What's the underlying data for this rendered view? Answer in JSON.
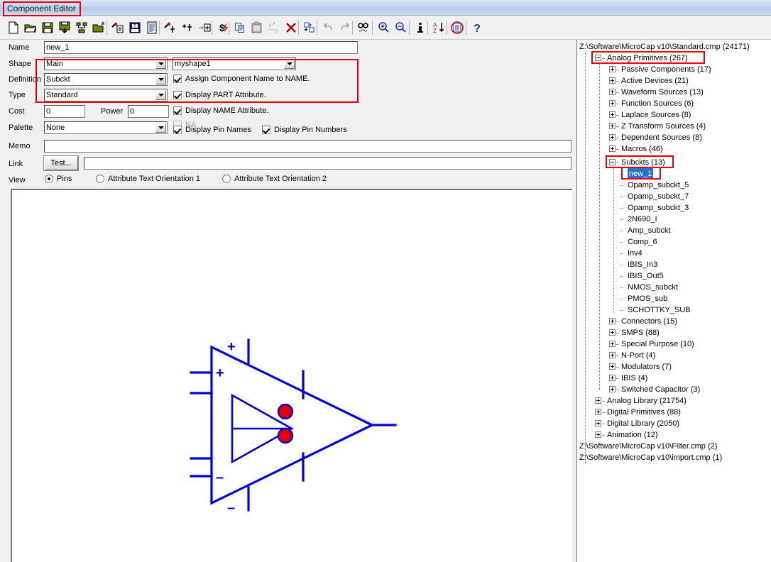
{
  "window": {
    "title": "Component Editor"
  },
  "toolbar": {
    "items": [
      {
        "name": "new-file-icon",
        "label": "New"
      },
      {
        "name": "open-folder-icon",
        "label": "Open"
      },
      {
        "name": "save-icon",
        "label": "Save"
      },
      {
        "name": "save-as-icon",
        "label": "Save As"
      },
      {
        "name": "merge-icon",
        "label": "Merge"
      },
      {
        "name": "add-folder-icon",
        "label": "Add Folder"
      },
      {
        "name": "add-part-wizard-icon",
        "label": "Add Part Wizard"
      },
      {
        "name": "add-part-icon",
        "label": "Add Part"
      },
      {
        "name": "add-group-icon",
        "label": "Add Group"
      },
      {
        "name": "subckt-wizard-icon",
        "label": "Subckt Wizard"
      },
      {
        "name": "add-pin-icon",
        "label": "Add Pin"
      },
      {
        "name": "move-into-icon",
        "label": "Move Into"
      },
      {
        "name": "cost-power-icon",
        "label": "Cost and Power"
      },
      {
        "name": "copy-icon",
        "label": "Copy"
      },
      {
        "name": "paste-icon",
        "label": "Paste"
      },
      {
        "name": "sort-ab-icon",
        "label": "Sort A to B"
      },
      {
        "name": "delete-icon",
        "label": "Delete"
      },
      {
        "name": "move-components-icon",
        "label": "Move Components"
      },
      {
        "name": "undo-icon",
        "label": "Undo"
      },
      {
        "name": "redo-icon",
        "label": "Redo"
      },
      {
        "name": "find-icon",
        "label": "Find"
      },
      {
        "name": "zoom-in-icon",
        "label": "Zoom In"
      },
      {
        "name": "zoom-out-icon",
        "label": "Zoom Out"
      },
      {
        "name": "info-icon",
        "label": "Info"
      },
      {
        "name": "sort-az-icon",
        "label": "Sort"
      },
      {
        "name": "filter-icon",
        "label": "Filter"
      },
      {
        "name": "help-icon",
        "label": "Help"
      }
    ]
  },
  "form": {
    "name": {
      "label": "Name",
      "value": "new_1"
    },
    "shape": {
      "label": "Shape",
      "value": "Main",
      "shape_name": "myshape1"
    },
    "definition": {
      "label": "Definition",
      "value": "Subckt"
    },
    "type": {
      "label": "Type",
      "value": "Standard"
    },
    "cost": {
      "label": "Cost",
      "value": "0"
    },
    "power": {
      "label": "Power",
      "value": "0"
    },
    "palette": {
      "label": "Palette",
      "value": "None"
    },
    "memo": {
      "label": "Memo",
      "value": ""
    },
    "link": {
      "label": "Link",
      "value": "",
      "test_button": "Test..."
    },
    "view": {
      "label": "View"
    },
    "checkboxes": [
      {
        "label": "Assign Component Name to NAME.",
        "checked": true,
        "disabled": false
      },
      {
        "label": "Display PART Attribute.",
        "checked": true,
        "disabled": false
      },
      {
        "label": "Display NAME Attribute.",
        "checked": true,
        "disabled": false
      },
      {
        "label": "NA",
        "checked": false,
        "disabled": true
      },
      {
        "label": "Display Pin Names",
        "checked": true,
        "disabled": false
      },
      {
        "label": "Display Pin Numbers",
        "checked": true,
        "disabled": false
      }
    ],
    "radios": [
      {
        "label": "Pins",
        "selected": true
      },
      {
        "label": "Attribute Text Orientation 1",
        "selected": false
      },
      {
        "label": "Attribute Text Orientation 2",
        "selected": false
      }
    ]
  },
  "symbol": {
    "plus_top": "+",
    "plus_in": "+",
    "minus_in": "–",
    "minus_bottom": "–",
    "line_color": "#0000d4",
    "pin_color": "#e00000"
  },
  "tree": {
    "files": [
      {
        "path": "Z:\\Software\\MicroCap v10\\Standard.cmp (24171)"
      },
      {
        "path": "Z:\\Software\\MicroCap v10\\Filter.cmp (2)"
      },
      {
        "path": "Z:\\Software\\MicroCap v10\\import.cmp (1)"
      }
    ],
    "groups": [
      {
        "label": "Analog Primitives (267)",
        "state": "expanded",
        "highlight": true
      },
      {
        "label": "Analog Library (21754)",
        "state": "collapsed",
        "highlight": false
      },
      {
        "label": "Digital Primitives (88)",
        "state": "collapsed",
        "highlight": false
      },
      {
        "label": "Digital Library (2050)",
        "state": "collapsed",
        "highlight": false
      },
      {
        "label": "Animation (12)",
        "state": "collapsed",
        "highlight": false
      }
    ],
    "analog_children": [
      {
        "label": "Passive Components (17)",
        "state": "collapsed"
      },
      {
        "label": "Active Devices (21)",
        "state": "collapsed"
      },
      {
        "label": "Waveform Sources (13)",
        "state": "collapsed"
      },
      {
        "label": "Function Sources (6)",
        "state": "collapsed"
      },
      {
        "label": "Laplace Sources (8)",
        "state": "collapsed"
      },
      {
        "label": "Z Transform Sources (4)",
        "state": "collapsed"
      },
      {
        "label": "Dependent Sources (8)",
        "state": "collapsed"
      },
      {
        "label": "Macros (46)",
        "state": "collapsed"
      },
      {
        "label": "Subckts (13)",
        "state": "expanded",
        "highlight": true
      },
      {
        "label": "Connectors (15)",
        "state": "collapsed"
      },
      {
        "label": "SMPS (88)",
        "state": "collapsed"
      },
      {
        "label": "Special Purpose (10)",
        "state": "collapsed"
      },
      {
        "label": "N-Port (4)",
        "state": "collapsed"
      },
      {
        "label": "Modulators (7)",
        "state": "collapsed"
      },
      {
        "label": "IBIS (4)",
        "state": "collapsed"
      },
      {
        "label": "Switched Capacitor (3)",
        "state": "collapsed"
      }
    ],
    "subckt_items": [
      {
        "label": "new_1",
        "selected": true,
        "highlight": true
      },
      {
        "label": "Opamp_subckt_5",
        "selected": false
      },
      {
        "label": "Opamp_subckt_7",
        "selected": false
      },
      {
        "label": "Opamp_subckt_3",
        "selected": false
      },
      {
        "label": "2N690_I",
        "selected": false
      },
      {
        "label": "Amp_subckt",
        "selected": false
      },
      {
        "label": "Comp_6",
        "selected": false
      },
      {
        "label": "Inv4",
        "selected": false
      },
      {
        "label": "IBIS_In3",
        "selected": false
      },
      {
        "label": "IBIS_Out5",
        "selected": false
      },
      {
        "label": "NMOS_subckt",
        "selected": false
      },
      {
        "label": "PMOS_sub",
        "selected": false
      },
      {
        "label": "SCHOTTKY_SUB",
        "selected": false
      }
    ]
  },
  "colors": {
    "highlight_red": "#e8000b",
    "selection_blue": "#2b6fd1"
  }
}
